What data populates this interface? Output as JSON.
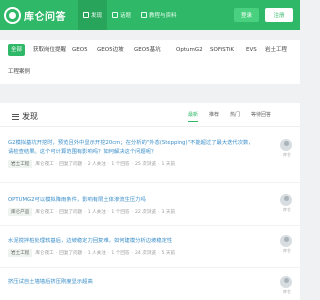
{
  "header": {
    "logo_text": "库仑问答",
    "nav": [
      {
        "label": "发现",
        "icon": "discover-icon"
      },
      {
        "label": "话题",
        "icon": "topic-icon"
      },
      {
        "label": "教程与资料",
        "icon": "book-icon"
      }
    ],
    "login_label": "登录",
    "register_label": "注册",
    "brand_color": "#2fb867"
  },
  "tags": [
    "全部",
    "获取岗位提醒",
    "GEO5",
    "GEO5边坡",
    "GEO5基坑",
    "OptumG2",
    "SOFiSTiK",
    "EVS",
    "岩土工程",
    "工程案例"
  ],
  "feed": {
    "section_title": "发现",
    "sort_tabs": [
      "最新",
      "推荐",
      "热门",
      "等待回答"
    ],
    "items": [
      {
        "title": "G2模拟基坑开挖时，预览且外中显示开挖20cm；在分析的\"外态(Stepping)\"不能超过了最大迭代次数，请检查结果。这个可计算范围有影响吗？如何解决这个问题呢？",
        "badge": "岩土工程",
        "author": "库仑夜工",
        "action": "回复了问题",
        "replies": "2 人关注",
        "answers": "1 个回答",
        "views": "25 次浏览",
        "time": "1 天前",
        "avatar_name": "库仑"
      },
      {
        "title": "OPTUMG2可以模拟降雨条件，影响有限土体渗流生压力吗",
        "badge": "库仑产品",
        "author": "库仑夜工",
        "action": "回复了问题",
        "replies": "1 人关注",
        "answers": "1 个回答",
        "views": "22 次浏览",
        "time": "3 天前",
        "avatar_name": "库仑"
      },
      {
        "title": "水泥搅拌桩处理软基后，边坡稳定力回复难，如何建模分析边坡稳定性",
        "badge": "岩土工程",
        "author": "库仑夜工",
        "action": "回复了问题",
        "replies": "1 人关注",
        "answers": "1 个回答",
        "views": "24 次浏览",
        "time": "5 天前",
        "avatar_name": "库仑"
      },
      {
        "title": "挤压试自土墙墙后挤压刚度显示超高",
        "avatar_name": "库仑"
      }
    ]
  }
}
